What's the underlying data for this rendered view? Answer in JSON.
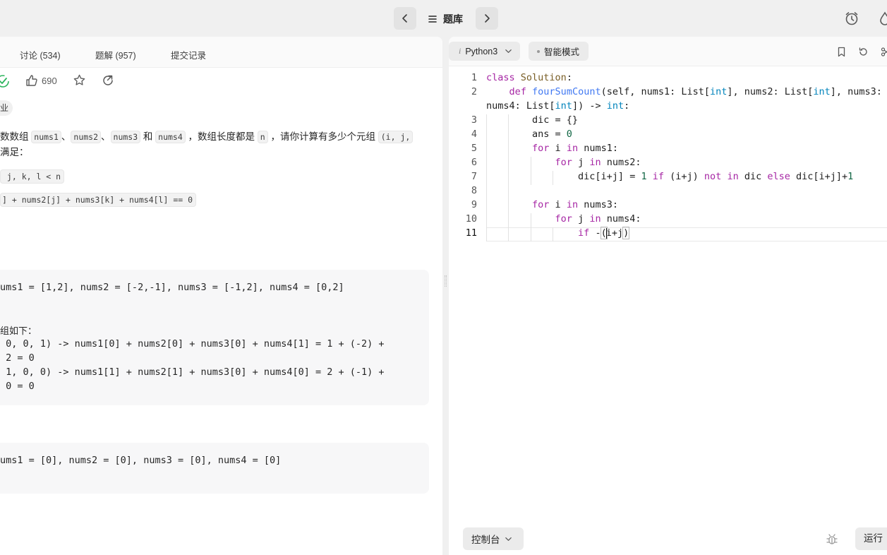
{
  "topbar": {
    "problem_list_label": "题库",
    "prev_label": "",
    "next_label": ""
  },
  "left": {
    "tabs": [
      {
        "label": "讨论 (534)"
      },
      {
        "label": "题解 (957)"
      },
      {
        "label": "提交记录"
      }
    ],
    "like_count": "690",
    "tag": "业",
    "desc": {
      "line1_a": "数数组 ",
      "c1": "nums1",
      "sep1": "、",
      "c2": "nums2",
      "sep2": "、",
      "c3": "nums3",
      "sep3": " 和 ",
      "c4": "nums4",
      "line1_b": " ，数组长度都是 ",
      "c5": "n",
      "line1_c": " ，请你计算有多少个元组 ",
      "c6": "(i, j,",
      "line2": "满足："
    },
    "conditions": [
      " j, k, l < n",
      "] + nums2[j] + nums3[k] + nums4[l] == 0"
    ],
    "example1": {
      "input": "ums1 = [1,2], nums2 = [-2,-1], nums3 = [-1,2], nums4 = [0,2]",
      "explain_head": "组如下：",
      "lines": [
        " 0, 0, 1) -> nums1[0] + nums2[0] + nums3[0] + nums4[1] = 1 + (-2) +",
        " 2 = 0",
        " 1, 0, 0) -> nums1[1] + nums2[1] + nums3[0] + nums4[0] = 2 + (-1) +",
        " 0 = 0"
      ]
    },
    "example2": {
      "input": "ums1 = [0], nums2 = [0], nums3 = [0], nums4 = [0]"
    }
  },
  "editor": {
    "language": "Python3",
    "mode": "智能模式",
    "line_numbers": [
      "1",
      "2",
      "",
      "3",
      "4",
      "5",
      "6",
      "7",
      "8",
      "9",
      "10",
      "11"
    ],
    "console_label": "控制台",
    "run_label": "运行"
  },
  "colors": {
    "keyword": "#a626a4",
    "function": "#4078f2",
    "type": "#0184bc",
    "number": "#116644",
    "accent_green": "#2db55d"
  }
}
